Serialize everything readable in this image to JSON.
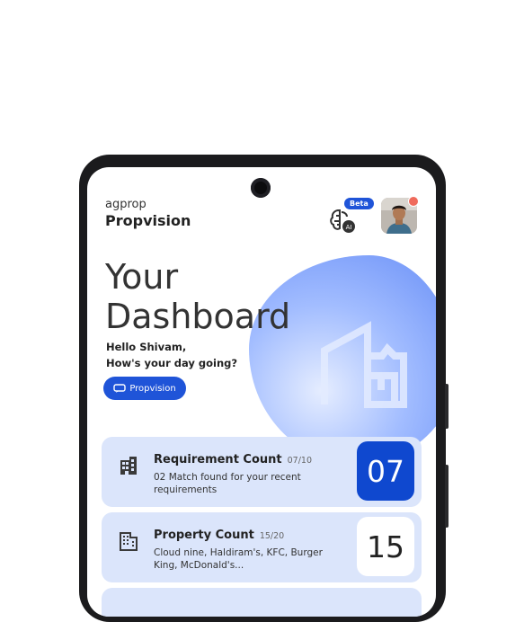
{
  "app": {
    "brand_small": "agprop",
    "brand_title": "Propvision",
    "beta_label": "Beta",
    "ai_badge": "AI"
  },
  "hero": {
    "title_line1": "Your",
    "title_line2": "Dashboard",
    "greeting_line1": "Hello Shivam,",
    "greeting_line2": "How's your day going?",
    "button_label": "Propvision"
  },
  "cards": [
    {
      "title": "Requirement  Count",
      "count": "07/10",
      "desc": "02 Match found for your recent requirements",
      "value": "07",
      "icon": "office-building-icon"
    },
    {
      "title": "Property Count",
      "count": "15/20",
      "desc": "Cloud nine, Haldiram's, KFC, Burger King, McDonald's...",
      "value": "15",
      "icon": "building-grid-icon"
    }
  ],
  "colors": {
    "accent": "#1f54d8",
    "card_bg": "#dbe5fb",
    "num_blue": "#0f48cf",
    "notification": "#ef6a5b"
  }
}
